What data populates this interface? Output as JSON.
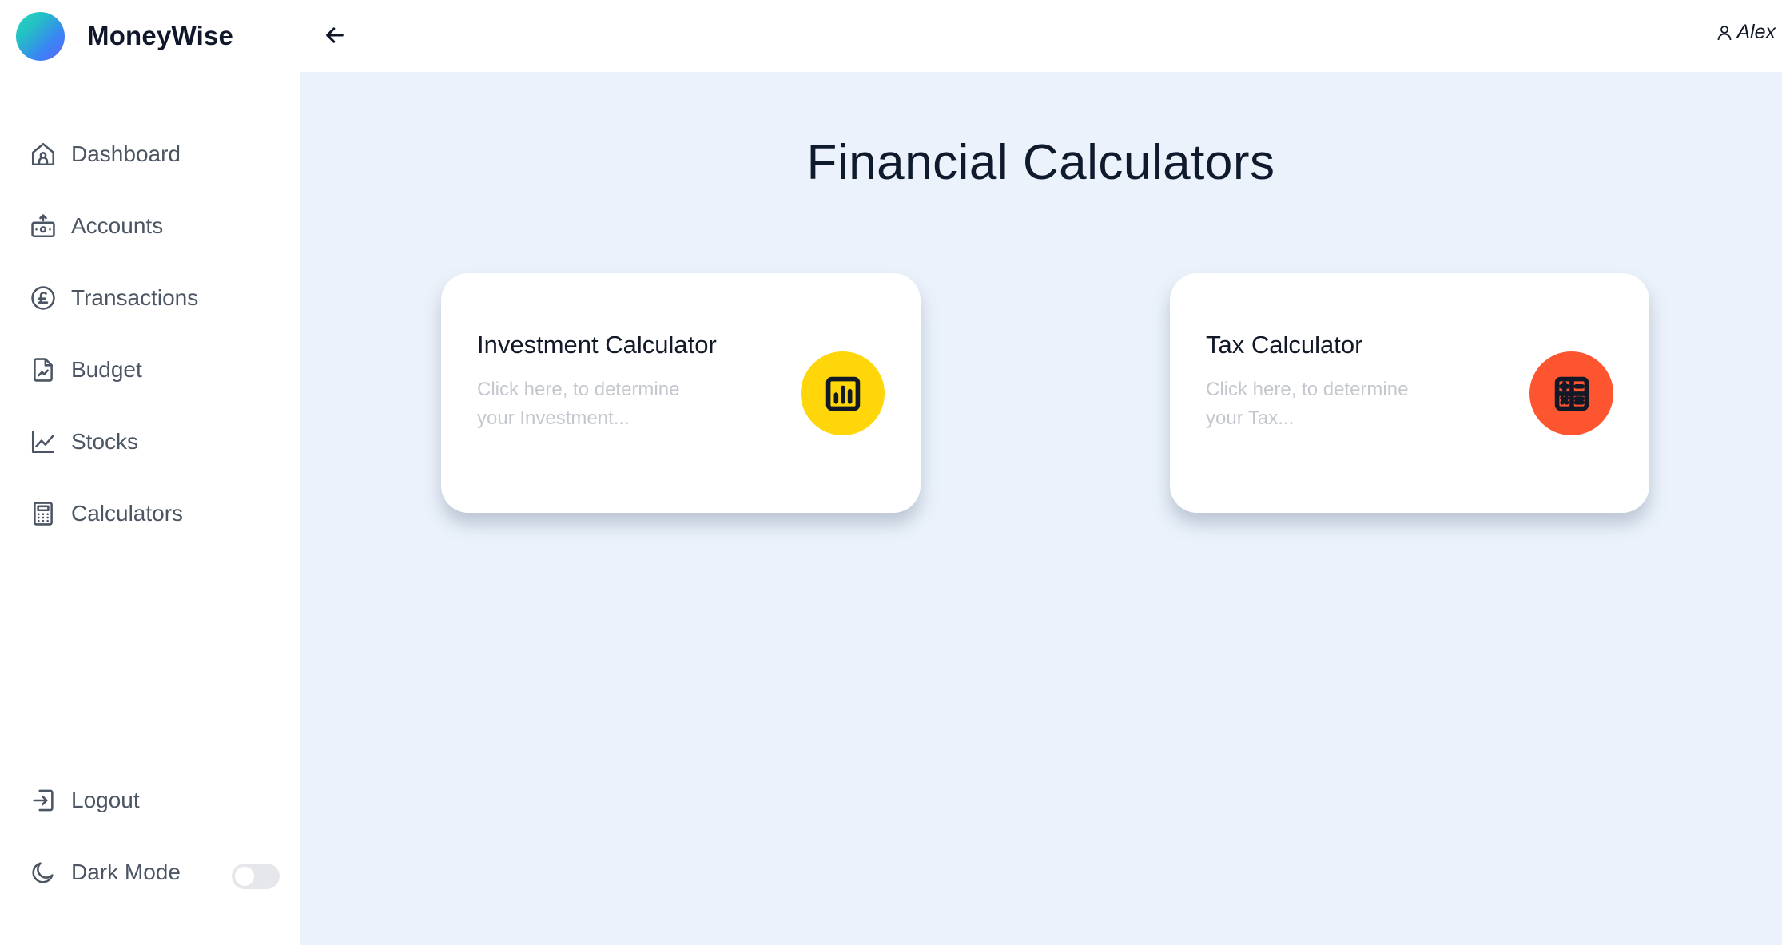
{
  "brand": {
    "name": "MoneyWise"
  },
  "sidebar": {
    "items": [
      {
        "label": "Dashboard",
        "icon": "home-icon"
      },
      {
        "label": "Accounts",
        "icon": "wallet-icon"
      },
      {
        "label": "Transactions",
        "icon": "pound-icon"
      },
      {
        "label": "Budget",
        "icon": "report-icon"
      },
      {
        "label": "Stocks",
        "icon": "chart-line-icon"
      },
      {
        "label": "Calculators",
        "icon": "calculator-icon"
      }
    ],
    "logout_label": "Logout",
    "dark_mode_label": "Dark Mode",
    "dark_mode_enabled": false
  },
  "header": {
    "user_name": "Alex"
  },
  "main": {
    "title": "Financial Calculators",
    "cards": [
      {
        "title": "Investment Calculator",
        "description": "Click here, to determine your Investment...",
        "icon": "bar-chart-icon",
        "icon_color": "#fed60a"
      },
      {
        "title": "Tax Calculator",
        "description": "Click here, to determine your Tax...",
        "icon": "calculator-icon",
        "icon_color": "#fc5530"
      }
    ]
  },
  "colors": {
    "main_background": "#ebf2fb",
    "sidebar_text": "#4b5563",
    "title_text": "#0f1b2d"
  }
}
